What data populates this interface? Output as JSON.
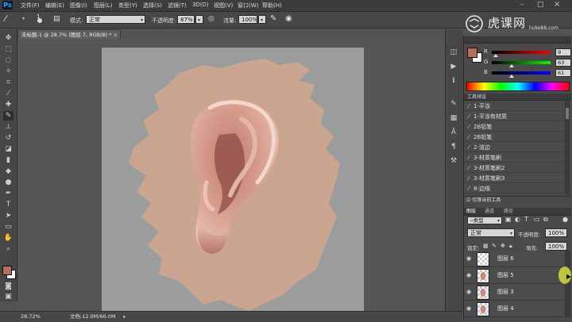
{
  "menubar": {
    "logo": "Ps",
    "items": [
      "文件(F)",
      "编辑(E)",
      "图像(I)",
      "图层(L)",
      "类型(Y)",
      "选择(S)",
      "滤镜(T)",
      "3D(D)",
      "视图(V)",
      "窗口(W)",
      "帮助(H)"
    ]
  },
  "options": {
    "brush_size": "1",
    "mode_label": "模式:",
    "mode_value": "正常",
    "opacity_label": "不透明度:",
    "opacity_value": "87%",
    "flow_label": "流量:",
    "flow_value": "100%"
  },
  "watermark": {
    "text": "虎课网",
    "url": "huke88.com"
  },
  "document": {
    "tab_title": "未标题-1 @ 28.7% (图层 7, RGB/8) *",
    "zoom": "28.72%",
    "doc_info": "文档:12.0M/66.0M"
  },
  "color_panel": {
    "r_label": "R",
    "g_label": "G",
    "b_label": "B",
    "r_value": "9",
    "g_value": "63",
    "b_value": "61",
    "foreground_color": "#b76d60",
    "background_color": "#ffffff"
  },
  "tool_presets": {
    "title": "工具预设",
    "items": [
      "1-平涂",
      "1-平涂有材质",
      "2B铅笔",
      "2B铅笔",
      "2-渲边",
      "3-材质笔刷",
      "3-材质笔刷2",
      "3-材质笔刷3",
      "8-边缘"
    ],
    "footer": "仅限当前工具"
  },
  "layers_panel": {
    "tabs": [
      "图层",
      "通道",
      "路径"
    ],
    "filter_label": "类型",
    "blend_mode": "正常",
    "opacity_label": "不透明度:",
    "opacity_value": "100%",
    "lock_label": "锁定:",
    "fill_label": "填充:",
    "fill_value": "100%",
    "layers": [
      {
        "name": "图层 6"
      },
      {
        "name": "图层 5"
      },
      {
        "name": "图层 3"
      },
      {
        "name": "图层 4"
      }
    ]
  },
  "colors": {
    "skin_base": "#caa58f",
    "canvas_bg": "#9b9d9d",
    "ui_dark": "#474747"
  }
}
